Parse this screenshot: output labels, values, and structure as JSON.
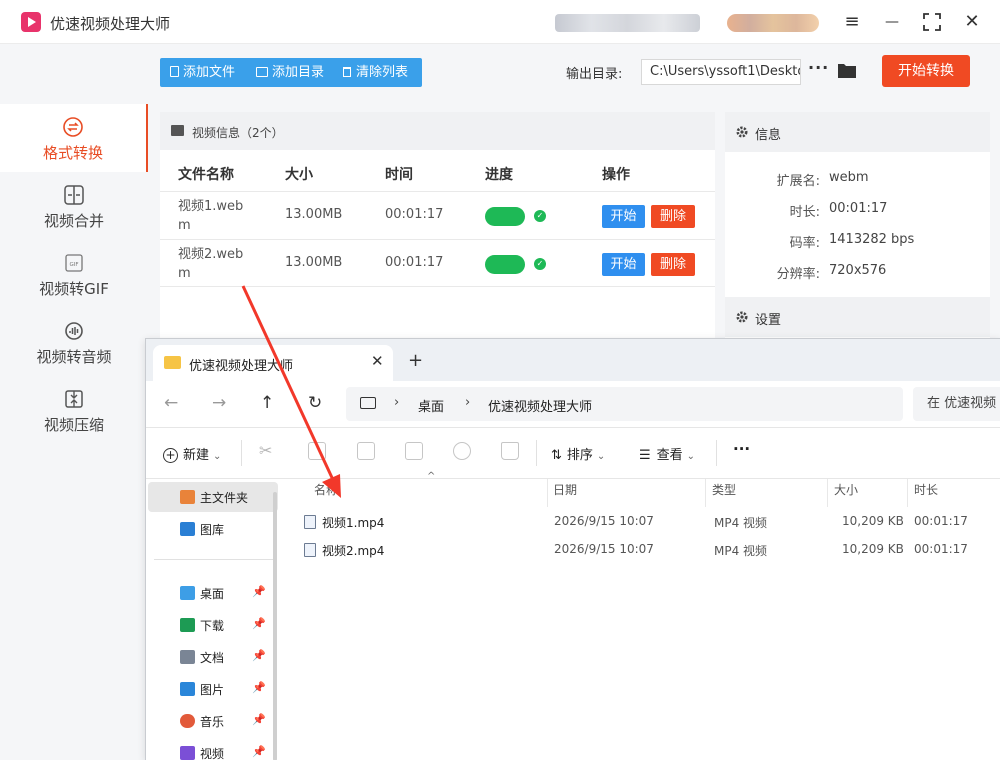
{
  "app": {
    "title": "优速视频处理大师"
  },
  "window_controls": {
    "menu": "≡",
    "minimize": "—",
    "maximize": "⛶",
    "close": "✕"
  },
  "sidebar": {
    "items": [
      {
        "label": "格式转换",
        "icon": "format-convert-icon",
        "active": true
      },
      {
        "label": "视频合并",
        "icon": "merge-icon",
        "active": false
      },
      {
        "label": "视频转GIF",
        "icon": "gif-icon",
        "active": false
      },
      {
        "label": "视频转音频",
        "icon": "audio-icon",
        "active": false
      },
      {
        "label": "视频压缩",
        "icon": "compress-icon",
        "active": false
      }
    ]
  },
  "toolbar": {
    "add_file": "添加文件",
    "add_folder": "添加目录",
    "clear_list": "清除列表",
    "output_label": "输出目录:",
    "output_path": "C:\\Users\\yssoft1\\Deskto",
    "more": "···",
    "start_all": "开始转换"
  },
  "file_list": {
    "title": "视频信息（2个）",
    "headers": {
      "name": "文件名称",
      "size": "大小",
      "time": "时间",
      "progress": "进度",
      "action": "操作"
    },
    "rows": [
      {
        "name1": "视频1.web",
        "name2": "m",
        "size": "13.00MB",
        "time": "00:01:17",
        "progress": 1.0,
        "start": "开始",
        "delete": "删除"
      },
      {
        "name1": "视频2.web",
        "name2": "m",
        "size": "13.00MB",
        "time": "00:01:17",
        "progress": 1.0,
        "start": "开始",
        "delete": "删除"
      }
    ]
  },
  "info": {
    "title": "信息",
    "rows": [
      {
        "key": "扩展名:",
        "value": "webm"
      },
      {
        "key": "时长:",
        "value": "00:01:17"
      },
      {
        "key": "码率:",
        "value": "1413282 bps"
      },
      {
        "key": "分辨率:",
        "value": "720x576"
      }
    ],
    "settings_title": "设置"
  },
  "explorer": {
    "tab_title": "优速视频处理大师",
    "tab_close": "✕",
    "new_tab": "+",
    "breadcrumbs": [
      "桌面",
      "优速视频处理大师"
    ],
    "search_placeholder": "在 优速视频",
    "commands": {
      "new": "新建",
      "sort": "排序",
      "view": "查看",
      "more": "···"
    },
    "nav_pane": [
      {
        "label": "主文件夹",
        "icon": "home-icon",
        "color": "#e9833a",
        "selected": true,
        "pinned": false
      },
      {
        "label": "图库",
        "icon": "gallery-icon",
        "color": "#2a7fd4",
        "selected": false,
        "pinned": false
      },
      {
        "label": "桌面",
        "icon": "desktop-icon",
        "color": "#3d9ee6",
        "selected": false,
        "pinned": true
      },
      {
        "label": "下载",
        "icon": "download-icon",
        "color": "#1d9b54",
        "selected": false,
        "pinned": true
      },
      {
        "label": "文档",
        "icon": "documents-icon",
        "color": "#7a8595",
        "selected": false,
        "pinned": true
      },
      {
        "label": "图片",
        "icon": "pictures-icon",
        "color": "#2a86d9",
        "selected": false,
        "pinned": true
      },
      {
        "label": "音乐",
        "icon": "music-icon",
        "color": "#e25a3a",
        "selected": false,
        "pinned": true
      },
      {
        "label": "视频",
        "icon": "videos-icon",
        "color": "#7b4fd6",
        "selected": false,
        "pinned": true
      }
    ],
    "pin_glyph": "📌",
    "file_headers": {
      "name": "名称",
      "date": "日期",
      "type": "类型",
      "size": "大小",
      "duration": "时长"
    },
    "files": [
      {
        "name": "视频1.mp4",
        "date": "2026/9/15 10:07",
        "type": "MP4 视频",
        "size": "10,209 KB",
        "duration": "00:01:17"
      },
      {
        "name": "视频2.mp4",
        "date": "2026/9/15 10:07",
        "type": "MP4 视频",
        "size": "10,209 KB",
        "duration": "00:01:17"
      }
    ]
  },
  "colors": {
    "accent_red": "#f04a23",
    "accent_blue": "#3aa0ea",
    "success_green": "#1eb956",
    "arrow_red": "#f2382a"
  }
}
